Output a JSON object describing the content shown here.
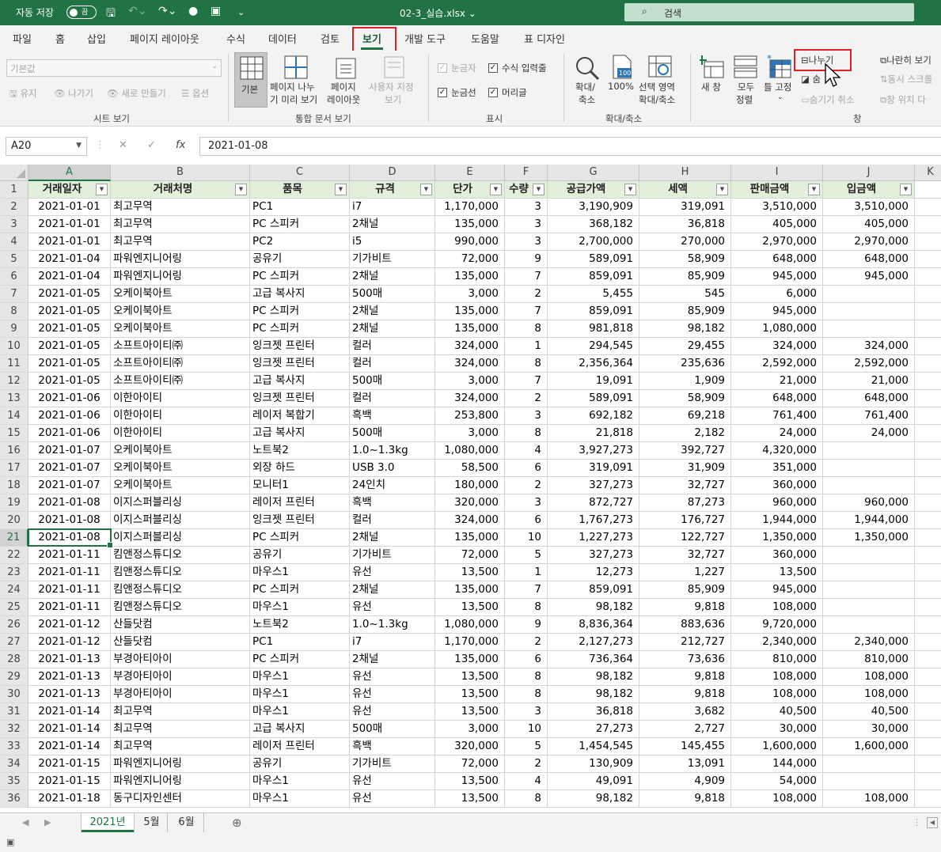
{
  "titlebar": {
    "autosave_label": "자동 저장",
    "autosave_state": "끔",
    "filename": "02-3_실습.xlsx",
    "search_placeholder": "검색"
  },
  "tabs": [
    "파일",
    "홈",
    "삽입",
    "페이지 레이아웃",
    "수식",
    "데이터",
    "검토",
    "보기",
    "개발 도구",
    "도움말",
    "표 디자인"
  ],
  "active_tab": "보기",
  "ribbon": {
    "sheet_view": {
      "combo_value": "기본값",
      "keep": "유지",
      "exit": "나가기",
      "new": "새로 만들기",
      "options": "옵션",
      "label": "시트 보기"
    },
    "workbook_views": {
      "normal": "기본",
      "page_break_1": "페이지 나누",
      "page_break_2": "기 미리 보기",
      "page_layout_1": "페이지",
      "page_layout_2": "레이아웃",
      "custom_1": "사용자 지정",
      "custom_2": "보기",
      "label": "통합 문서 보기"
    },
    "show": {
      "ruler": "눈금자",
      "formula_bar": "수식 입력줄",
      "gridlines": "눈금선",
      "headings": "머리글",
      "label": "표시"
    },
    "zoom": {
      "zoom_1": "확대/",
      "zoom_2": "축소",
      "hundred": "100%",
      "selection_1": "선택 영역",
      "selection_2": "확대/축소",
      "label": "확대/축소"
    },
    "window": {
      "new_window": "새 창",
      "arrange_1": "모두",
      "arrange_2": "정렬",
      "freeze": "틀 고정",
      "split": "나누기",
      "hide": "숨",
      "unhide": "숨기기 취소",
      "side_by_side": "나란히 보기",
      "sync_scroll": "동시 스크롤",
      "reset_pos": "창 위치 다",
      "label": "창"
    }
  },
  "formula_bar": {
    "name_box": "A20",
    "fx": "fx",
    "value": "2021-01-08"
  },
  "columns": [
    "A",
    "B",
    "C",
    "D",
    "E",
    "F",
    "G",
    "H",
    "I",
    "J",
    "K"
  ],
  "headers": [
    "거래일자",
    "거래처명",
    "품목",
    "규격",
    "단가",
    "수량",
    "공급가액",
    "세액",
    "판매금액",
    "입금액"
  ],
  "rows": [
    [
      "2021-01-01",
      "최고무역",
      "PC1",
      "i7",
      "1,170,000",
      "3",
      "3,190,909",
      "319,091",
      "3,510,000",
      "3,510,000"
    ],
    [
      "2021-01-01",
      "최고무역",
      "PC 스피커",
      "2채널",
      "135,000",
      "3",
      "368,182",
      "36,818",
      "405,000",
      "405,000"
    ],
    [
      "2021-01-01",
      "최고무역",
      "PC2",
      "i5",
      "990,000",
      "3",
      "2,700,000",
      "270,000",
      "2,970,000",
      "2,970,000"
    ],
    [
      "2021-01-04",
      "파워엔지니어링",
      "공유기",
      "기가비트",
      "72,000",
      "9",
      "589,091",
      "58,909",
      "648,000",
      "648,000"
    ],
    [
      "2021-01-04",
      "파워엔지니어링",
      "PC 스피커",
      "2채널",
      "135,000",
      "7",
      "859,091",
      "85,909",
      "945,000",
      "945,000"
    ],
    [
      "2021-01-05",
      "오케이북아트",
      "고급 복사지",
      "500매",
      "3,000",
      "2",
      "5,455",
      "545",
      "6,000",
      ""
    ],
    [
      "2021-01-05",
      "오케이북아트",
      "PC 스피커",
      "2채널",
      "135,000",
      "7",
      "859,091",
      "85,909",
      "945,000",
      ""
    ],
    [
      "2021-01-05",
      "오케이북아트",
      "PC 스피커",
      "2채널",
      "135,000",
      "8",
      "981,818",
      "98,182",
      "1,080,000",
      ""
    ],
    [
      "2021-01-05",
      "소프트아이티㈜",
      "잉크젯 프린터",
      "컬러",
      "324,000",
      "1",
      "294,545",
      "29,455",
      "324,000",
      "324,000"
    ],
    [
      "2021-01-05",
      "소프트아이티㈜",
      "잉크젯 프린터",
      "컬러",
      "324,000",
      "8",
      "2,356,364",
      "235,636",
      "2,592,000",
      "2,592,000"
    ],
    [
      "2021-01-05",
      "소프트아이티㈜",
      "고급 복사지",
      "500매",
      "3,000",
      "7",
      "19,091",
      "1,909",
      "21,000",
      "21,000"
    ],
    [
      "2021-01-06",
      "이한아이티",
      "잉크젯 프린터",
      "컬러",
      "324,000",
      "2",
      "589,091",
      "58,909",
      "648,000",
      "648,000"
    ],
    [
      "2021-01-06",
      "이한아이티",
      "레이저 복합기",
      "흑백",
      "253,800",
      "3",
      "692,182",
      "69,218",
      "761,400",
      "761,400"
    ],
    [
      "2021-01-06",
      "이한아이티",
      "고급 복사지",
      "500매",
      "3,000",
      "8",
      "21,818",
      "2,182",
      "24,000",
      "24,000"
    ],
    [
      "2021-01-07",
      "오케이북아트",
      "노트북2",
      "1.0~1.3kg",
      "1,080,000",
      "4",
      "3,927,273",
      "392,727",
      "4,320,000",
      ""
    ],
    [
      "2021-01-07",
      "오케이북아트",
      "외장 하드",
      "USB 3.0",
      "58,500",
      "6",
      "319,091",
      "31,909",
      "351,000",
      ""
    ],
    [
      "2021-01-07",
      "오케이북아트",
      "모니터1",
      "24인치",
      "180,000",
      "2",
      "327,273",
      "32,727",
      "360,000",
      ""
    ],
    [
      "2021-01-08",
      "이지스퍼블리싱",
      "레이저 프린터",
      "흑백",
      "320,000",
      "3",
      "872,727",
      "87,273",
      "960,000",
      "960,000"
    ],
    [
      "2021-01-08",
      "이지스퍼블리싱",
      "잉크젯 프린터",
      "컬러",
      "324,000",
      "6",
      "1,767,273",
      "176,727",
      "1,944,000",
      "1,944,000"
    ],
    [
      "2021-01-08",
      "이지스퍼블리싱",
      "PC 스피커",
      "2채널",
      "135,000",
      "10",
      "1,227,273",
      "122,727",
      "1,350,000",
      "1,350,000"
    ],
    [
      "2021-01-11",
      "킴앤정스튜디오",
      "공유기",
      "기가비트",
      "72,000",
      "5",
      "327,273",
      "32,727",
      "360,000",
      ""
    ],
    [
      "2021-01-11",
      "킴앤정스튜디오",
      "마우스1",
      "유선",
      "13,500",
      "1",
      "12,273",
      "1,227",
      "13,500",
      ""
    ],
    [
      "2021-01-11",
      "킴앤정스튜디오",
      "PC 스피커",
      "2채널",
      "135,000",
      "7",
      "859,091",
      "85,909",
      "945,000",
      ""
    ],
    [
      "2021-01-11",
      "킴앤정스튜디오",
      "마우스1",
      "유선",
      "13,500",
      "8",
      "98,182",
      "9,818",
      "108,000",
      ""
    ],
    [
      "2021-01-12",
      "산들닷컴",
      "노트북2",
      "1.0~1.3kg",
      "1,080,000",
      "9",
      "8,836,364",
      "883,636",
      "9,720,000",
      ""
    ],
    [
      "2021-01-12",
      "산들닷컴",
      "PC1",
      "i7",
      "1,170,000",
      "2",
      "2,127,273",
      "212,727",
      "2,340,000",
      "2,340,000"
    ],
    [
      "2021-01-13",
      "부경아티아이",
      "PC 스피커",
      "2채널",
      "135,000",
      "6",
      "736,364",
      "73,636",
      "810,000",
      "810,000"
    ],
    [
      "2021-01-13",
      "부경아티아이",
      "마우스1",
      "유선",
      "13,500",
      "8",
      "98,182",
      "9,818",
      "108,000",
      "108,000"
    ],
    [
      "2021-01-13",
      "부경아티아이",
      "마우스1",
      "유선",
      "13,500",
      "8",
      "98,182",
      "9,818",
      "108,000",
      "108,000"
    ],
    [
      "2021-01-14",
      "최고무역",
      "마우스1",
      "유선",
      "13,500",
      "3",
      "36,818",
      "3,682",
      "40,500",
      "40,500"
    ],
    [
      "2021-01-14",
      "최고무역",
      "고급 복사지",
      "500매",
      "3,000",
      "10",
      "27,273",
      "2,727",
      "30,000",
      "30,000"
    ],
    [
      "2021-01-14",
      "최고무역",
      "레이저 프린터",
      "흑백",
      "320,000",
      "5",
      "1,454,545",
      "145,455",
      "1,600,000",
      "1,600,000"
    ],
    [
      "2021-01-15",
      "파워엔지니어링",
      "공유기",
      "기가비트",
      "72,000",
      "2",
      "130,909",
      "13,091",
      "144,000",
      ""
    ],
    [
      "2021-01-15",
      "파워엔지니어링",
      "마우스1",
      "유선",
      "13,500",
      "4",
      "49,091",
      "4,909",
      "54,000",
      ""
    ],
    [
      "2021-01-18",
      "동구디자인센터",
      "마우스1",
      "유선",
      "13,500",
      "8",
      "98,182",
      "9,818",
      "108,000",
      "108,000"
    ]
  ],
  "sheets": [
    "2021년",
    "5월",
    "6월"
  ],
  "active_sheet": "2021년",
  "colors": {
    "excel_green": "#217346",
    "header_fill": "#e2efda",
    "highlight": "#e31e24"
  }
}
